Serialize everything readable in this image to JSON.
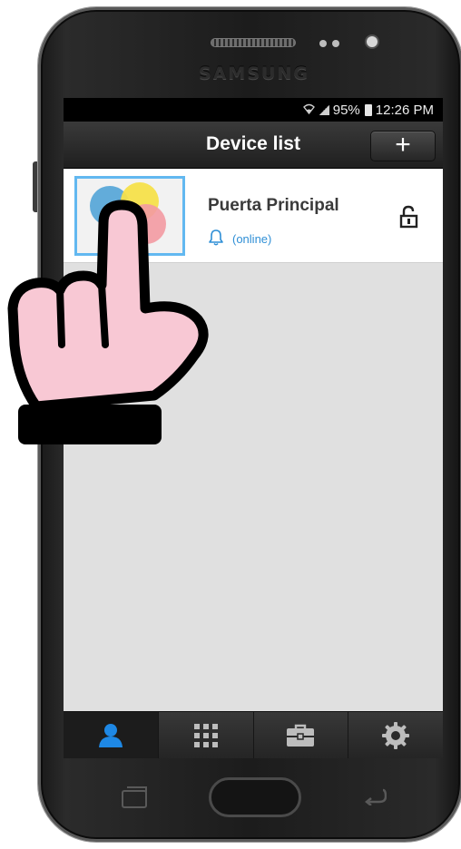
{
  "device": {
    "brand": "SAMSUNG"
  },
  "status_bar": {
    "battery": "95%",
    "time": "12:26 PM",
    "icons": [
      "wifi-icon",
      "signal-icon",
      "battery-icon"
    ]
  },
  "header": {
    "title": "Device list",
    "add_button_label": "+"
  },
  "devices": [
    {
      "name": "Puerta Principal",
      "status": "(online)",
      "icons": [
        "bell-icon",
        "unlocked-padlock-icon"
      ]
    }
  ],
  "tabs": [
    {
      "icon": "user-icon",
      "active": true
    },
    {
      "icon": "grid-icon",
      "active": false
    },
    {
      "icon": "briefcase-icon",
      "active": false
    },
    {
      "icon": "gear-icon",
      "active": false
    }
  ],
  "colors": {
    "accent": "#2f8fd6",
    "thumbnail_border": "#62b8f0",
    "tab_active": "#1e88e5",
    "hand_fill": "#f8c8d4"
  }
}
